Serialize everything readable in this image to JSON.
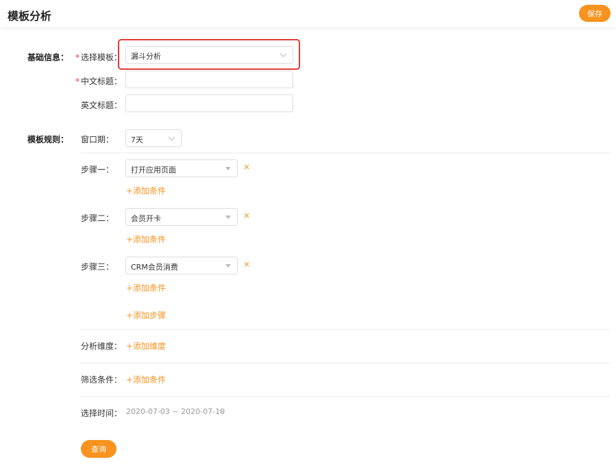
{
  "header": {
    "title": "模板分析",
    "save_label": "保存"
  },
  "basic_info": {
    "section_label": "基础信息：",
    "template": {
      "label": "选择模板：",
      "value": "漏斗分析"
    },
    "cn_title": {
      "label": "中文标题：",
      "value": ""
    },
    "en_title": {
      "label": "英文标题：",
      "value": ""
    }
  },
  "rules": {
    "section_label": "模板规则：",
    "window": {
      "label": "窗口期：",
      "value": "7天"
    },
    "steps": [
      {
        "label": "步骤一：",
        "value": "打开应用页面",
        "add_condition": "+添加条件"
      },
      {
        "label": "步骤二：",
        "value": "会员开卡",
        "add_condition": "+添加条件"
      },
      {
        "label": "步骤三：",
        "value": "CRM会员消费",
        "add_condition": "+添加条件"
      }
    ],
    "remove_glyph": "×",
    "add_step": "+添加步骤",
    "dimension": {
      "label": "分析维度：",
      "add": "+添加维度"
    },
    "filter": {
      "label": "筛选条件：",
      "add": "+添加条件"
    },
    "time": {
      "label": "选择时间：",
      "value": "2020-07-03 ~ 2020-07-10"
    }
  },
  "query_label": "查询",
  "colors": {
    "accent": "#f7931e",
    "required": "#e53935",
    "highlight": "#e53935"
  }
}
